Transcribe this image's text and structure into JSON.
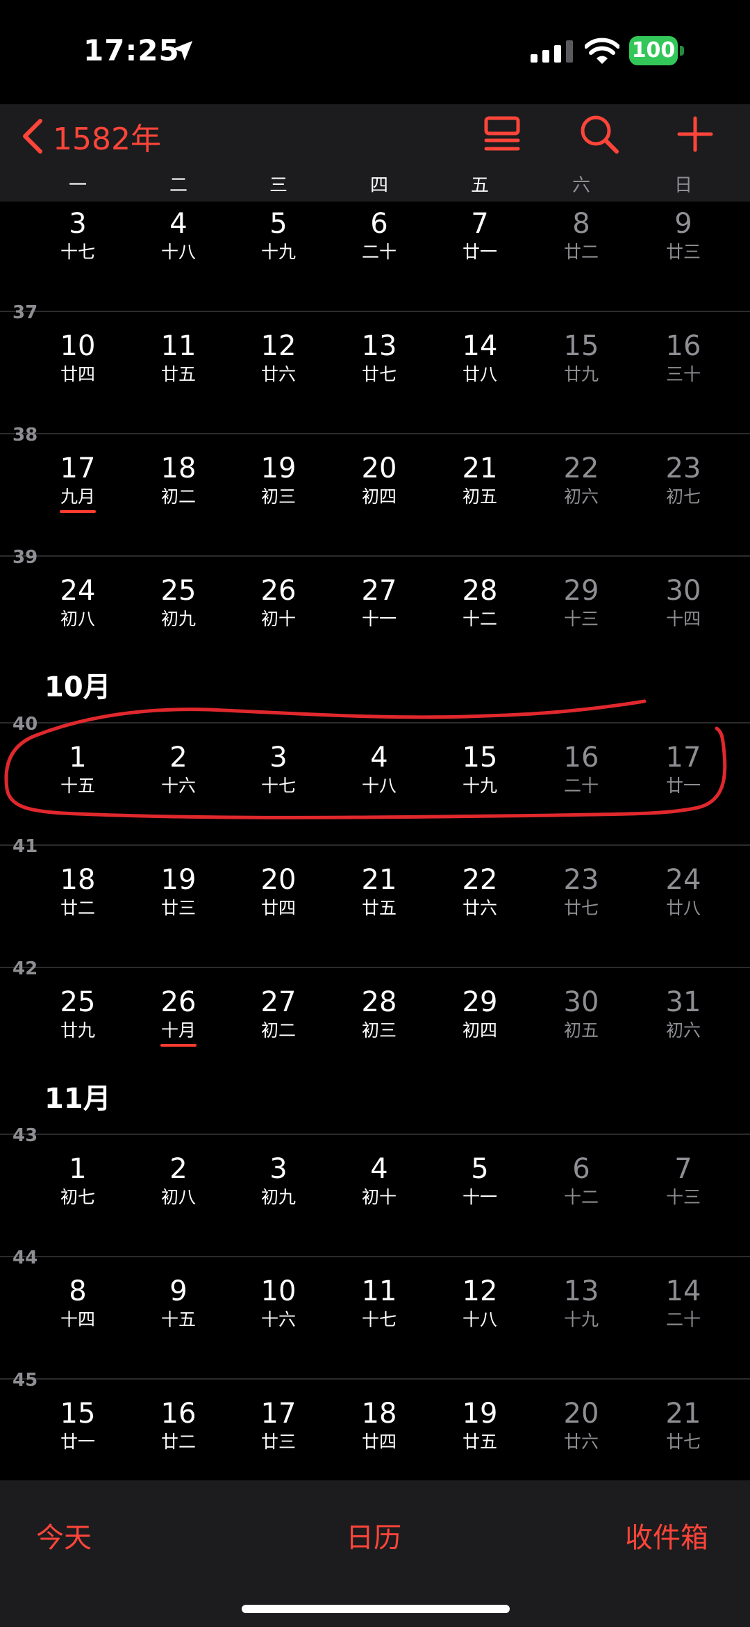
{
  "status": {
    "time": "17:25",
    "battery": "100"
  },
  "nav": {
    "back_label": "1582年",
    "icons": [
      "list-view-icon",
      "search-icon",
      "plus-icon"
    ]
  },
  "weekdays": [
    "一",
    "二",
    "三",
    "四",
    "五",
    "六",
    "日"
  ],
  "weeks": [
    {
      "week": "",
      "month_label": "",
      "days": [
        [
          "3",
          "十七"
        ],
        [
          "4",
          "十八"
        ],
        [
          "5",
          "十九"
        ],
        [
          "6",
          "二十"
        ],
        [
          "7",
          "廿一"
        ],
        [
          "8",
          "廿二"
        ],
        [
          "9",
          "廿三"
        ]
      ]
    },
    {
      "week": "37",
      "month_label": "",
      "days": [
        [
          "10",
          "廿四"
        ],
        [
          "11",
          "廿五"
        ],
        [
          "12",
          "廿六"
        ],
        [
          "13",
          "廿七"
        ],
        [
          "14",
          "廿八"
        ],
        [
          "15",
          "廿九"
        ],
        [
          "16",
          "三十"
        ]
      ]
    },
    {
      "week": "38",
      "month_label": "",
      "days": [
        [
          "17",
          "九月"
        ],
        [
          "18",
          "初二"
        ],
        [
          "19",
          "初三"
        ],
        [
          "20",
          "初四"
        ],
        [
          "21",
          "初五"
        ],
        [
          "22",
          "初六"
        ],
        [
          "23",
          "初七"
        ]
      ]
    },
    {
      "week": "39",
      "month_label": "",
      "days": [
        [
          "24",
          "初八"
        ],
        [
          "25",
          "初九"
        ],
        [
          "26",
          "初十"
        ],
        [
          "27",
          "十一"
        ],
        [
          "28",
          "十二"
        ],
        [
          "29",
          "十三"
        ],
        [
          "30",
          "十四"
        ]
      ]
    },
    {
      "week": "40",
      "month_label": "10月",
      "days": [
        [
          "1",
          "十五"
        ],
        [
          "2",
          "十六"
        ],
        [
          "3",
          "十七"
        ],
        [
          "4",
          "十八"
        ],
        [
          "15",
          "十九"
        ],
        [
          "16",
          "二十"
        ],
        [
          "17",
          "廿一"
        ]
      ]
    },
    {
      "week": "41",
      "month_label": "",
      "days": [
        [
          "18",
          "廿二"
        ],
        [
          "19",
          "廿三"
        ],
        [
          "20",
          "廿四"
        ],
        [
          "21",
          "廿五"
        ],
        [
          "22",
          "廿六"
        ],
        [
          "23",
          "廿七"
        ],
        [
          "24",
          "廿八"
        ]
      ]
    },
    {
      "week": "42",
      "month_label": "",
      "days": [
        [
          "25",
          "廿九"
        ],
        [
          "26",
          "十月"
        ],
        [
          "27",
          "初二"
        ],
        [
          "28",
          "初三"
        ],
        [
          "29",
          "初四"
        ],
        [
          "30",
          "初五"
        ],
        [
          "31",
          "初六"
        ]
      ]
    },
    {
      "week": "43",
      "month_label": "11月",
      "days": [
        [
          "1",
          "初七"
        ],
        [
          "2",
          "初八"
        ],
        [
          "3",
          "初九"
        ],
        [
          "4",
          "初十"
        ],
        [
          "5",
          "十一"
        ],
        [
          "6",
          "十二"
        ],
        [
          "7",
          "十三"
        ]
      ]
    },
    {
      "week": "44",
      "month_label": "",
      "days": [
        [
          "8",
          "十四"
        ],
        [
          "9",
          "十五"
        ],
        [
          "10",
          "十六"
        ],
        [
          "11",
          "十七"
        ],
        [
          "12",
          "十八"
        ],
        [
          "13",
          "十九"
        ],
        [
          "14",
          "二十"
        ]
      ]
    },
    {
      "week": "45",
      "month_label": "",
      "days": [
        [
          "15",
          "廿一"
        ],
        [
          "16",
          "廿二"
        ],
        [
          "17",
          "廿三"
        ],
        [
          "18",
          "廿四"
        ],
        [
          "19",
          "廿五"
        ],
        [
          "20",
          "廿六"
        ],
        [
          "21",
          "廿七"
        ]
      ]
    }
  ],
  "underlined_lunar": [
    "九月",
    "十月"
  ],
  "tabs": {
    "today": "今天",
    "calendars": "日历",
    "inbox": "收件箱"
  },
  "colors": {
    "accent": "#ff453a",
    "weekend": "#8e8e93",
    "battery": "#33c759",
    "annotation": "#e0282d"
  }
}
